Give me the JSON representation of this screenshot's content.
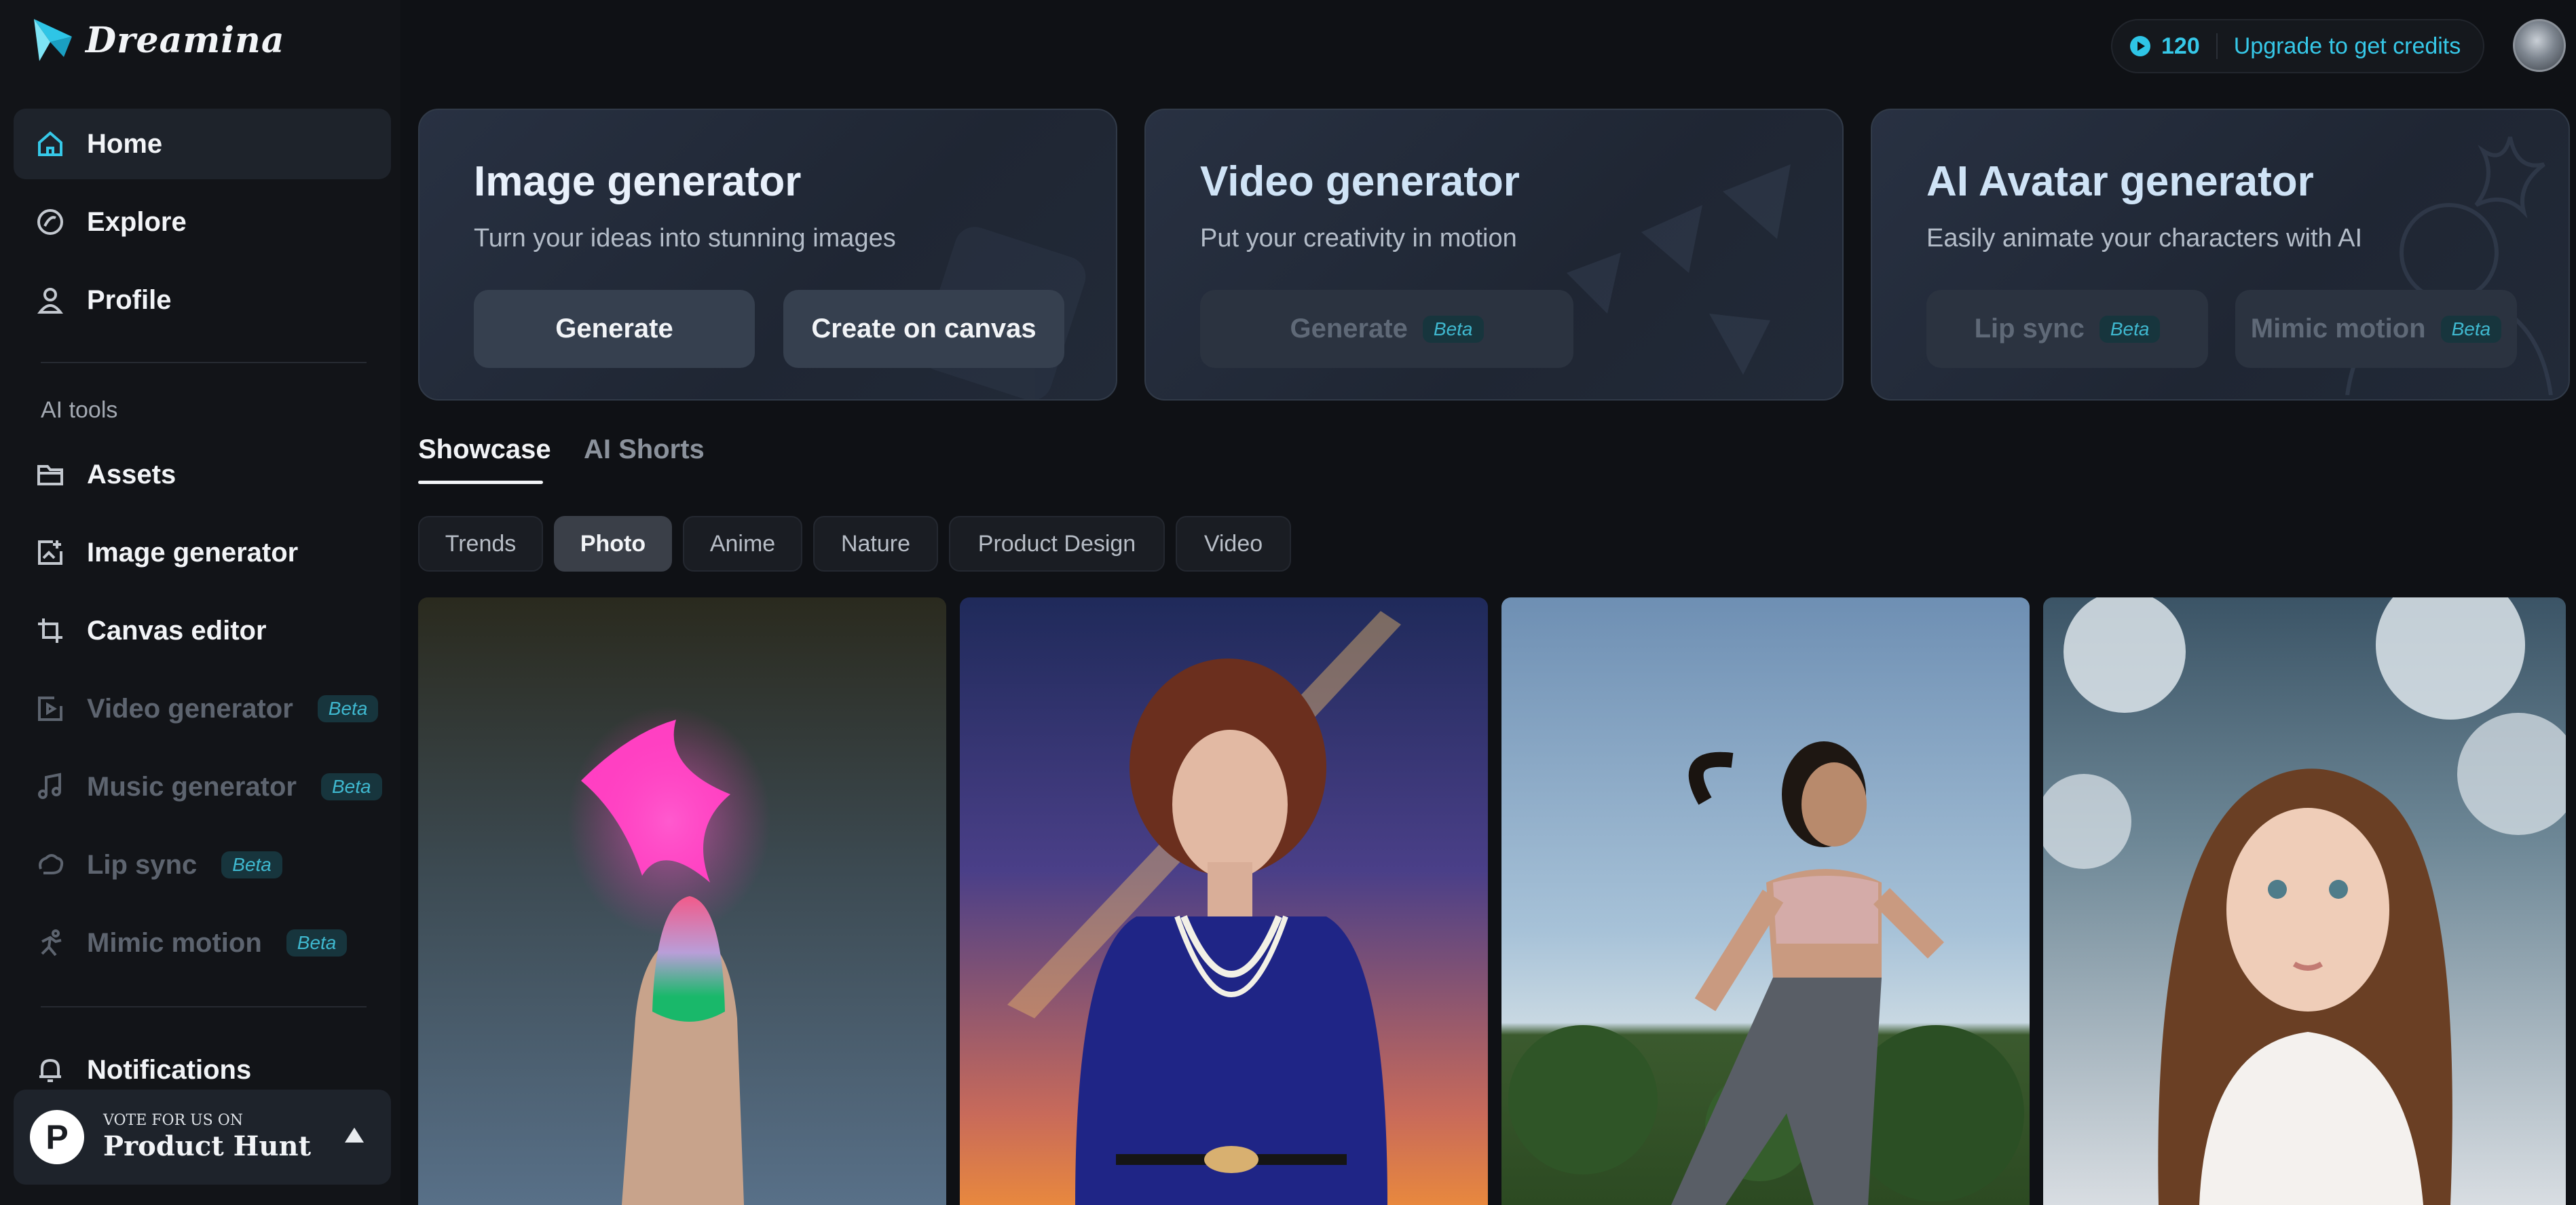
{
  "app": {
    "name": "Dreamina"
  },
  "sidebar": {
    "main_items": [
      {
        "label": "Home",
        "icon": "home-icon"
      },
      {
        "label": "Explore",
        "icon": "compass-icon"
      },
      {
        "label": "Profile",
        "icon": "user-icon"
      }
    ],
    "section_label": "AI tools",
    "tool_items": [
      {
        "label": "Assets",
        "icon": "folder-icon"
      },
      {
        "label": "Image generator",
        "icon": "image-plus-icon"
      },
      {
        "label": "Canvas editor",
        "icon": "crop-icon"
      },
      {
        "label": "Video generator",
        "icon": "video-icon",
        "badge": "Beta"
      },
      {
        "label": "Music generator",
        "icon": "music-icon",
        "badge": "Beta"
      },
      {
        "label": "Lip sync",
        "icon": "lip-sync-icon",
        "badge": "Beta"
      },
      {
        "label": "Mimic motion",
        "icon": "motion-icon",
        "badge": "Beta"
      }
    ],
    "notifications_label": "Notifications",
    "product_hunt": {
      "small": "VOTE FOR US ON",
      "big": "Product Hunt",
      "logo_letter": "P"
    }
  },
  "header": {
    "credits": "120",
    "upgrade_label": "Upgrade to get credits"
  },
  "cards": {
    "image": {
      "title": "Image generator",
      "subtitle": "Turn your ideas into stunning images",
      "generate_label": "Generate",
      "canvas_label": "Create on canvas"
    },
    "video": {
      "title": "Video generator",
      "subtitle": "Put your creativity in motion",
      "generate_label": "Generate",
      "badge": "Beta"
    },
    "avatar": {
      "title": "AI Avatar generator",
      "subtitle": "Easily animate your characters with AI",
      "lip_sync_label": "Lip sync",
      "mimic_label": "Mimic motion",
      "badge": "Beta"
    }
  },
  "tabs": {
    "showcase": "Showcase",
    "ai_shorts": "AI Shorts"
  },
  "chips": [
    "Trends",
    "Photo",
    "Anime",
    "Nature",
    "Product Design",
    "Video"
  ],
  "active_chip": "Photo",
  "gallery": [
    {
      "subject": "glowing-fingernail"
    },
    {
      "subject": "woman-rainbow"
    },
    {
      "subject": "runner"
    },
    {
      "subject": "snow-portrait"
    }
  ],
  "colors": {
    "accent": "#36c8e8",
    "background": "#0f1115",
    "sidebar": "#121418"
  }
}
